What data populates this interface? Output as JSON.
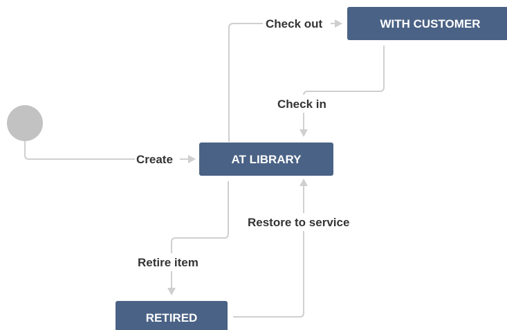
{
  "colors": {
    "state_fill": "#4a6285",
    "state_text": "#ffffff",
    "edge_line": "#cfcfcf",
    "edge_label": "#333333",
    "start_node": "#c2c2c2"
  },
  "states": {
    "with_customer": "WITH CUSTOMER",
    "at_library": "AT LIBRARY",
    "retired": "RETIRED"
  },
  "transitions": {
    "create": "Create",
    "check_out": "Check out",
    "check_in": "Check in",
    "retire_item": "Retire item",
    "restore_to_service": "Restore to service"
  }
}
